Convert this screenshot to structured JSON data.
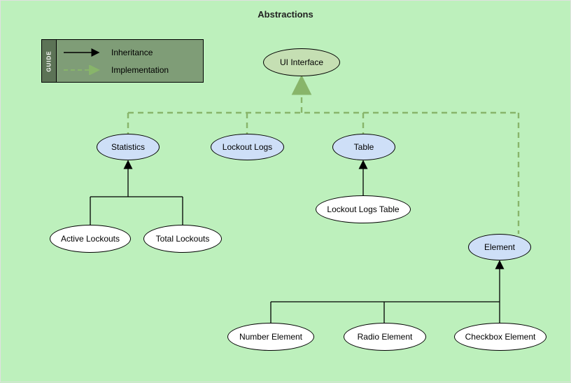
{
  "title": "Abstractions",
  "guide": {
    "tab": "GUIDE",
    "inheritance": "Inheritance",
    "implementation": "Implementation"
  },
  "nodes": {
    "ui_interface": "UI Interface",
    "statistics": "Statistics",
    "lockout_logs": "Lockout Logs",
    "table": "Table",
    "element": "Element",
    "active_lockouts": "Active Lockouts",
    "total_lockouts": "Total Lockouts",
    "lockout_logs_table": "Lockout Logs Table",
    "number_element": "Number Element",
    "radio_element": "Radio Element",
    "checkbox_element": "Checkbox Element"
  },
  "chart_data": {
    "type": "graph",
    "title": "Abstractions",
    "edge_styles": {
      "inheritance": {
        "solid": true,
        "color": "#000000"
      },
      "implementation": {
        "dashed": true,
        "color": "#88b56a"
      }
    },
    "nodes": [
      {
        "id": "ui_interface",
        "label": "UI Interface",
        "kind": "interface"
      },
      {
        "id": "statistics",
        "label": "Statistics",
        "kind": "abstract"
      },
      {
        "id": "lockout_logs",
        "label": "Lockout Logs",
        "kind": "abstract"
      },
      {
        "id": "table",
        "label": "Table",
        "kind": "abstract"
      },
      {
        "id": "element",
        "label": "Element",
        "kind": "abstract"
      },
      {
        "id": "active_lockouts",
        "label": "Active Lockouts",
        "kind": "concrete"
      },
      {
        "id": "total_lockouts",
        "label": "Total Lockouts",
        "kind": "concrete"
      },
      {
        "id": "lockout_logs_table",
        "label": "Lockout Logs Table",
        "kind": "concrete"
      },
      {
        "id": "number_element",
        "label": "Number Element",
        "kind": "concrete"
      },
      {
        "id": "radio_element",
        "label": "Radio Element",
        "kind": "concrete"
      },
      {
        "id": "checkbox_element",
        "label": "Checkbox Element",
        "kind": "concrete"
      }
    ],
    "edges": [
      {
        "from": "statistics",
        "to": "ui_interface",
        "type": "implementation"
      },
      {
        "from": "lockout_logs",
        "to": "ui_interface",
        "type": "implementation"
      },
      {
        "from": "table",
        "to": "ui_interface",
        "type": "implementation"
      },
      {
        "from": "element",
        "to": "ui_interface",
        "type": "implementation"
      },
      {
        "from": "active_lockouts",
        "to": "statistics",
        "type": "inheritance"
      },
      {
        "from": "total_lockouts",
        "to": "statistics",
        "type": "inheritance"
      },
      {
        "from": "lockout_logs_table",
        "to": "table",
        "type": "inheritance"
      },
      {
        "from": "number_element",
        "to": "element",
        "type": "inheritance"
      },
      {
        "from": "radio_element",
        "to": "element",
        "type": "inheritance"
      },
      {
        "from": "checkbox_element",
        "to": "element",
        "type": "inheritance"
      }
    ]
  }
}
